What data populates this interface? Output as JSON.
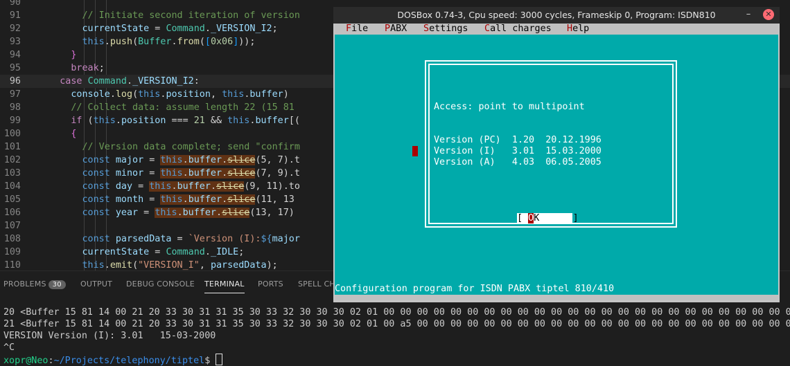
{
  "editor": {
    "active_line": "96",
    "lines": [
      {
        "n": "90",
        "indent": "      ",
        "parts": []
      },
      {
        "n": "91",
        "indent": "        ",
        "parts": [
          {
            "t": "// Initiate second iteration of version",
            "c": "c-com"
          }
        ]
      },
      {
        "n": "92",
        "indent": "        ",
        "parts": [
          {
            "t": "currentState",
            "c": "c-var"
          },
          {
            "t": " = "
          },
          {
            "t": "Command",
            "c": "c-cls"
          },
          {
            "t": "."
          },
          {
            "t": "_VERSION_I2",
            "c": "c-var"
          },
          {
            "t": ";"
          }
        ]
      },
      {
        "n": "93",
        "indent": "        ",
        "parts": [
          {
            "t": "this",
            "c": "c-this"
          },
          {
            "t": "."
          },
          {
            "t": "push",
            "c": "c-fn"
          },
          {
            "t": "("
          },
          {
            "t": "Buffer",
            "c": "c-cls"
          },
          {
            "t": "."
          },
          {
            "t": "from",
            "c": "c-fn"
          },
          {
            "t": "("
          },
          {
            "t": "[",
            "c": "c-brk2"
          },
          {
            "t": "0x06",
            "c": "c-num"
          },
          {
            "t": "]",
            "c": "c-brk2"
          },
          {
            "t": "));"
          }
        ]
      },
      {
        "n": "94",
        "indent": "      ",
        "parts": [
          {
            "t": "}",
            "c": "c-brk"
          }
        ]
      },
      {
        "n": "95",
        "indent": "      ",
        "parts": [
          {
            "t": "break",
            "c": "c-kw"
          },
          {
            "t": ";"
          }
        ]
      },
      {
        "n": "96",
        "indent": "    ",
        "parts": [
          {
            "t": "case",
            "c": "c-kw"
          },
          {
            "t": " "
          },
          {
            "t": "Command",
            "c": "c-cls"
          },
          {
            "t": "."
          },
          {
            "t": "_VERSION_I2",
            "c": "c-var"
          },
          {
            "t": ":"
          }
        ]
      },
      {
        "n": "97",
        "indent": "      ",
        "parts": [
          {
            "t": "console",
            "c": "c-var"
          },
          {
            "t": "."
          },
          {
            "t": "log",
            "c": "c-fn"
          },
          {
            "t": "("
          },
          {
            "t": "this",
            "c": "c-this"
          },
          {
            "t": "."
          },
          {
            "t": "position",
            "c": "c-var"
          },
          {
            "t": ", "
          },
          {
            "t": "this",
            "c": "c-this"
          },
          {
            "t": "."
          },
          {
            "t": "buffer",
            "c": "c-var"
          },
          {
            "t": ")"
          }
        ]
      },
      {
        "n": "98",
        "indent": "      ",
        "parts": [
          {
            "t": "// Collect data: assume length 22 (15 81",
            "c": "c-com"
          }
        ]
      },
      {
        "n": "99",
        "indent": "      ",
        "parts": [
          {
            "t": "if",
            "c": "c-kw"
          },
          {
            "t": " ("
          },
          {
            "t": "this",
            "c": "c-this"
          },
          {
            "t": "."
          },
          {
            "t": "position",
            "c": "c-var"
          },
          {
            "t": " === "
          },
          {
            "t": "21",
            "c": "c-num"
          },
          {
            "t": " && "
          },
          {
            "t": "this",
            "c": "c-this"
          },
          {
            "t": "."
          },
          {
            "t": "buffer",
            "c": "c-var"
          },
          {
            "t": "[("
          }
        ]
      },
      {
        "n": "100",
        "indent": "      ",
        "parts": [
          {
            "t": "{",
            "c": "c-brk"
          }
        ]
      },
      {
        "n": "101",
        "indent": "        ",
        "parts": [
          {
            "t": "// Version data complete; send \"confirm",
            "c": "c-com"
          }
        ]
      },
      {
        "n": "102",
        "indent": "        ",
        "parts": [
          {
            "t": "const",
            "c": "c-dec"
          },
          {
            "t": " "
          },
          {
            "t": "major",
            "c": "c-var"
          },
          {
            "t": " = "
          },
          {
            "t": "this",
            "c": "c-this",
            "h": 1
          },
          {
            "t": ".",
            "h": 1
          },
          {
            "t": "buffer",
            "c": "c-var",
            "h": 1
          },
          {
            "t": ".",
            "h": 1
          },
          {
            "t": "slice",
            "c": "c-fn strike",
            "h": 1
          },
          {
            "t": "(5, 7).t"
          }
        ]
      },
      {
        "n": "103",
        "indent": "        ",
        "parts": [
          {
            "t": "const",
            "c": "c-dec"
          },
          {
            "t": " "
          },
          {
            "t": "minor",
            "c": "c-var"
          },
          {
            "t": " = "
          },
          {
            "t": "this",
            "c": "c-this",
            "h": 1
          },
          {
            "t": ".",
            "h": 1
          },
          {
            "t": "buffer",
            "c": "c-var",
            "h": 1
          },
          {
            "t": ".",
            "h": 1
          },
          {
            "t": "slice",
            "c": "c-fn strike",
            "h": 1
          },
          {
            "t": "(7, 9).t"
          }
        ]
      },
      {
        "n": "104",
        "indent": "        ",
        "parts": [
          {
            "t": "const",
            "c": "c-dec"
          },
          {
            "t": " "
          },
          {
            "t": "day",
            "c": "c-var"
          },
          {
            "t": " = "
          },
          {
            "t": "this",
            "c": "c-this",
            "h": 1
          },
          {
            "t": ".",
            "h": 1
          },
          {
            "t": "buffer",
            "c": "c-var",
            "h": 1
          },
          {
            "t": ".",
            "h": 1
          },
          {
            "t": "slice",
            "c": "c-fn strike",
            "h": 1
          },
          {
            "t": "(9, 11).to"
          }
        ]
      },
      {
        "n": "105",
        "indent": "        ",
        "parts": [
          {
            "t": "const",
            "c": "c-dec"
          },
          {
            "t": " "
          },
          {
            "t": "month",
            "c": "c-var"
          },
          {
            "t": " = "
          },
          {
            "t": "this",
            "c": "c-this",
            "h": 1
          },
          {
            "t": ".",
            "h": 1
          },
          {
            "t": "buffer",
            "c": "c-var",
            "h": 1
          },
          {
            "t": ".",
            "h": 1
          },
          {
            "t": "slice",
            "c": "c-fn strike",
            "h": 1
          },
          {
            "t": "(11, 13"
          }
        ]
      },
      {
        "n": "106",
        "indent": "        ",
        "parts": [
          {
            "t": "const",
            "c": "c-dec"
          },
          {
            "t": " "
          },
          {
            "t": "year",
            "c": "c-var"
          },
          {
            "t": " = "
          },
          {
            "t": "this",
            "c": "c-this",
            "h": 1
          },
          {
            "t": ".",
            "h": 1
          },
          {
            "t": "buffer",
            "c": "c-var",
            "h": 1
          },
          {
            "t": ".",
            "h": 1
          },
          {
            "t": "slice",
            "c": "c-fn strike",
            "h": 1
          },
          {
            "t": "(13, 17)"
          }
        ]
      },
      {
        "n": "107",
        "indent": "",
        "parts": []
      },
      {
        "n": "108",
        "indent": "        ",
        "parts": [
          {
            "t": "const",
            "c": "c-dec"
          },
          {
            "t": " "
          },
          {
            "t": "parsedData",
            "c": "c-var"
          },
          {
            "t": " = "
          },
          {
            "t": "`Version (I):",
            "c": "c-str"
          },
          {
            "t": "${",
            "c": "c-dec"
          },
          {
            "t": "major",
            "c": "c-var"
          }
        ]
      },
      {
        "n": "109",
        "indent": "        ",
        "parts": [
          {
            "t": "currentState",
            "c": "c-var"
          },
          {
            "t": " = "
          },
          {
            "t": "Command",
            "c": "c-cls"
          },
          {
            "t": "."
          },
          {
            "t": "_IDLE",
            "c": "c-var"
          },
          {
            "t": ";"
          }
        ]
      },
      {
        "n": "110",
        "indent": "        ",
        "parts": [
          {
            "t": "this",
            "c": "c-this"
          },
          {
            "t": "."
          },
          {
            "t": "emit",
            "c": "c-fn"
          },
          {
            "t": "("
          },
          {
            "t": "\"VERSION_I\"",
            "c": "c-str"
          },
          {
            "t": ", "
          },
          {
            "t": "parsedData",
            "c": "c-var"
          },
          {
            "t": ");"
          }
        ]
      }
    ]
  },
  "panel": {
    "tabs": [
      {
        "label": "PROBLEMS",
        "badge": "30"
      },
      {
        "label": "OUTPUT"
      },
      {
        "label": "DEBUG CONSOLE"
      },
      {
        "label": "TERMINAL",
        "active": true
      },
      {
        "label": "PORTS"
      },
      {
        "label": "SPELL CHE"
      }
    ]
  },
  "terminal": {
    "line1": "20 <Buffer 15 81 14 00 21 20 33 30 31 31 35 30 33 32 30 30 30 02 01 00 00 00 00 00 00 00 00 00 00 00 00 00 00 00 00 00 00 00 00 00 00 00 00 00 00 00 00",
    "line2": "21 <Buffer 15 81 14 00 21 20 33 30 31 31 35 30 33 32 30 30 30 02 01 00 a5 00 00 00 00 00 00 00 00 00 00 00 00 00 00 00 00 00 00 00 00 00 00 00 00 00 00",
    "line3": "VERSION Version (I): 3.01   15-03-2000",
    "line4": "^C",
    "prompt_user": "xopr@Neo",
    "prompt_sep": ":",
    "prompt_path": "~/Projects/telephony/tiptel",
    "prompt_end": "$ "
  },
  "dosbox": {
    "title": "DOSBox 0.74-3, Cpu speed:   3000 cycles, Frameskip  0, Program:  ISDN810",
    "minimize_icon": "minimize-icon",
    "close_icon": "close-icon",
    "menu": [
      {
        "hot": "F",
        "rest": "ile"
      },
      {
        "hot": "P",
        "rest": "ABX"
      },
      {
        "hot": "S",
        "rest": "ettings"
      },
      {
        "hot": "C",
        "rest": "all charges"
      },
      {
        "hot": "H",
        "rest": "elp"
      }
    ],
    "dialog": {
      "access": "Access: point to multipoint",
      "v_pc": "Version (PC)  1.20  20.12.1996",
      "v_i": "Version (I)   3.01  15.03.2000",
      "v_a": "Version (A)   4.03  06.05.2005",
      "ok_open": "[ ",
      "ok_hot": "O",
      "ok_rest": "K      ]"
    },
    "status": "Configuration program for ISDN PABX tiptel 810/410",
    "colors": {
      "background": "#00aaaa",
      "menubar": "#c0c0c0",
      "hotkey": "#aa0000"
    }
  }
}
